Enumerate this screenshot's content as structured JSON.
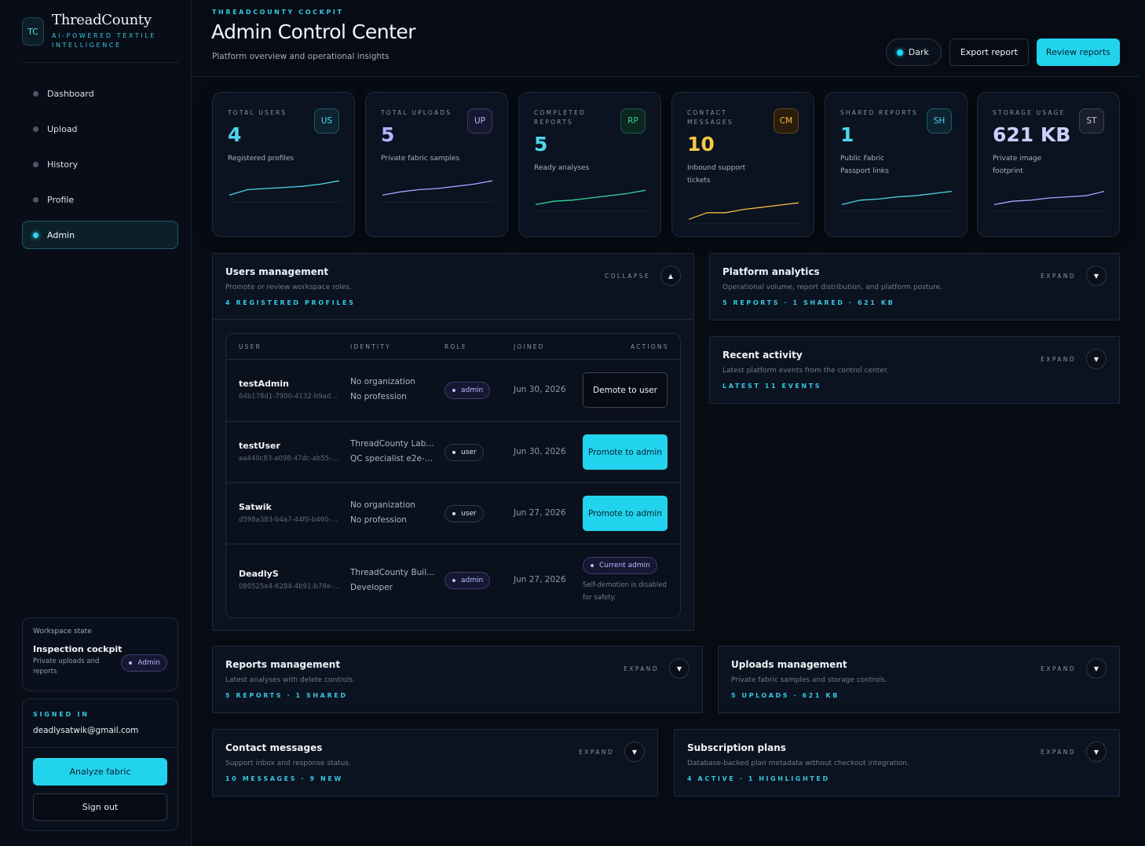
{
  "brand": {
    "initials": "TC",
    "name": "ThreadCounty",
    "tagline": "AI-POWERED TEXTILE INTELLIGENCE"
  },
  "nav": [
    {
      "label": "Dashboard"
    },
    {
      "label": "Upload"
    },
    {
      "label": "History"
    },
    {
      "label": "Profile"
    },
    {
      "label": "Admin",
      "active": true
    }
  ],
  "workspace": {
    "title": "Workspace state",
    "name": "Inspection cockpit",
    "desc": "Private uploads and reports",
    "badge": "Admin"
  },
  "account": {
    "label": "SIGNED IN",
    "email": "deadlysatwik@gmail.com",
    "analyze": "Analyze fabric",
    "signout": "Sign out"
  },
  "header": {
    "eyebrow": "THREADCOUNTY COCKPIT",
    "title": "Admin Control Center",
    "subtitle": "Platform overview and operational insights",
    "theme": "Dark",
    "export": "Export report",
    "review": "Review reports"
  },
  "metrics": [
    {
      "label": "TOTAL USERS",
      "badge": "US",
      "value": "4",
      "desc": "Registered profiles",
      "color": "#4fd6ec",
      "trend": [
        0.2,
        0.45,
        0.5,
        0.55,
        0.6,
        0.7,
        0.85
      ]
    },
    {
      "label": "TOTAL UPLOADS",
      "badge": "UP",
      "value": "5",
      "desc": "Private fabric samples",
      "color": "#a5a6ff",
      "trend": [
        0.2,
        0.35,
        0.45,
        0.5,
        0.6,
        0.7,
        0.85
      ]
    },
    {
      "label": "COMPLETED REPORTS",
      "badge": "RP",
      "value": "5",
      "desc": "Ready analyses",
      "color": "#34d399",
      "trend": [
        0.2,
        0.35,
        0.4,
        0.5,
        0.6,
        0.7,
        0.85
      ]
    },
    {
      "label": "CONTACT MESSAGES",
      "badge": "CM",
      "value": "10",
      "desc": "Inbound support tickets",
      "color": "#f5b941",
      "trend": [
        0.1,
        0.4,
        0.4,
        0.55,
        0.65,
        0.75,
        0.85
      ]
    },
    {
      "label": "SHARED REPORTS",
      "badge": "SH",
      "value": "1",
      "desc": "Public Fabric Passport links",
      "color": "#4fd6ec",
      "trend": [
        0.2,
        0.4,
        0.45,
        0.55,
        0.6,
        0.7,
        0.8
      ]
    },
    {
      "label": "STORAGE USAGE",
      "badge": "ST",
      "value": "621 KB",
      "desc": "Private image footprint",
      "color": "#a5a6ff",
      "trend": [
        0.2,
        0.35,
        0.4,
        0.5,
        0.55,
        0.6,
        0.8
      ]
    }
  ],
  "users_panel": {
    "title": "Users management",
    "subtitle": "Promote or review workspace roles.",
    "meta": "4 REGISTERED PROFILES",
    "toggle": "COLLAPSE",
    "columns": [
      "USER",
      "IDENTITY",
      "ROLE",
      "JOINED",
      "ACTIONS"
    ],
    "rows": [
      {
        "name": "testAdmin",
        "id": "64b178d1-7900-4132-b9ad…",
        "org": "No organization",
        "prof": "No profession",
        "role": "admin",
        "joined": "Jun 30, 2026",
        "action": "Demote to user"
      },
      {
        "name": "testUser",
        "id": "aa440c83-a098-47dc-ab55-…",
        "org": "ThreadCounty Lab…",
        "prof": "QC specialist e2e-p…",
        "role": "user",
        "joined": "Jun 30, 2026",
        "action": "Promote to admin"
      },
      {
        "name": "Satwik",
        "id": "d598a383-b4a7-44f0-b460-…",
        "org": "No organization",
        "prof": "No profession",
        "role": "user",
        "joined": "Jun 27, 2026",
        "action": "Promote to admin"
      },
      {
        "name": "DeadlyS",
        "id": "080525e4-6284-4b91-b78e-…",
        "org": "ThreadCounty Buil…",
        "prof": "Developer",
        "role": "admin",
        "joined": "Jun 27, 2026",
        "action": "Current admin",
        "note": "Self-demotion is disabled for safety."
      }
    ]
  },
  "panels": {
    "analytics": {
      "title": "Platform analytics",
      "subtitle": "Operational volume, report distribution, and platform posture.",
      "meta": "5 REPORTS · 1 SHARED · 621 KB",
      "toggle": "EXPAND"
    },
    "activity": {
      "title": "Recent activity",
      "subtitle": "Latest platform events from the control center.",
      "meta": "LATEST 11 EVENTS",
      "toggle": "EXPAND"
    },
    "reports": {
      "title": "Reports management",
      "subtitle": "Latest analyses with delete controls.",
      "meta": "5 REPORTS · 1 SHARED",
      "toggle": "EXPAND"
    },
    "uploads": {
      "title": "Uploads management",
      "subtitle": "Private fabric samples and storage controls.",
      "meta": "5 UPLOADS · 621 KB",
      "toggle": "EXPAND"
    },
    "contact": {
      "title": "Contact messages",
      "subtitle": "Support inbox and response status.",
      "meta": "10 MESSAGES · 9 NEW",
      "toggle": "EXPAND"
    },
    "plans": {
      "title": "Subscription plans",
      "subtitle": "Database-backed plan metadata without checkout integration.",
      "meta": "4 ACTIVE · 1 HIGHLIGHTED",
      "toggle": "EXPAND"
    }
  },
  "icons": {
    "up": "chevron-up-icon",
    "down": "chevron-down-icon"
  }
}
